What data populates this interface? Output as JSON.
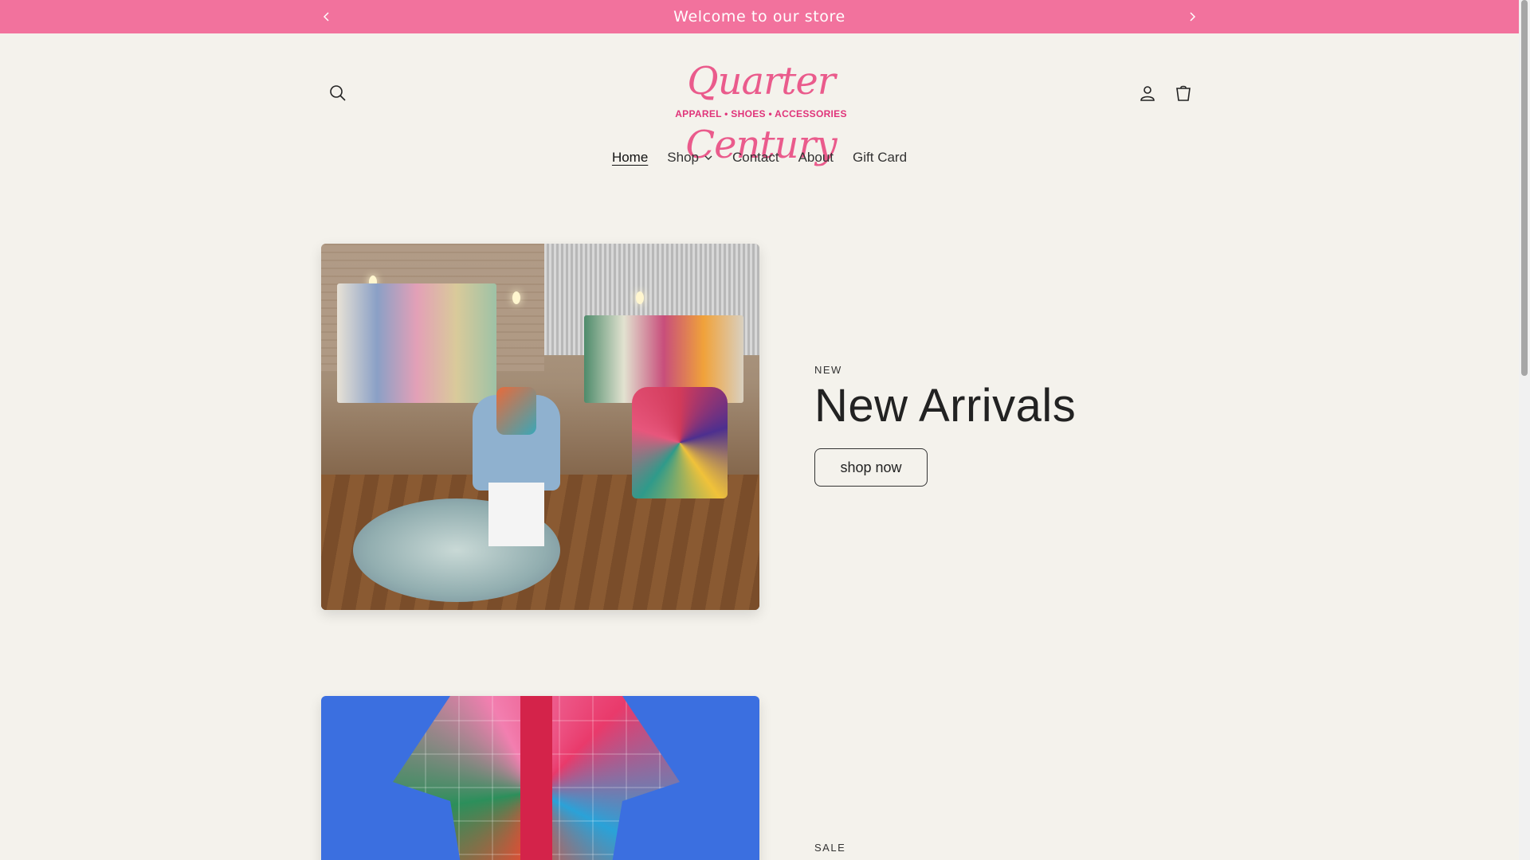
{
  "announcement": {
    "text": "Welcome to our store",
    "prev_icon": "chevron-left-icon",
    "next_icon": "chevron-right-icon"
  },
  "header": {
    "logo": {
      "script": "Quarter Century",
      "tagline": "APPAREL • SHOES • ACCESSORIES"
    },
    "icons": [
      "search-icon",
      "account-icon",
      "cart-icon"
    ]
  },
  "nav": {
    "items": [
      {
        "label": "Home",
        "active": true
      },
      {
        "label": "Shop",
        "has_dropdown": true
      },
      {
        "label": "Contact"
      },
      {
        "label": "About"
      },
      {
        "label": "Gift Card"
      }
    ]
  },
  "features": [
    {
      "eyebrow": "NEW",
      "heading": "New Arrivals",
      "button": "shop now",
      "image": "store-interior"
    },
    {
      "eyebrow": "SALE",
      "image": "colorful-dress"
    }
  ],
  "colors": {
    "announcement_bg": "#f2729d",
    "logo_pink": "#ea5b8c",
    "page_bg": "#f4f2ec"
  }
}
